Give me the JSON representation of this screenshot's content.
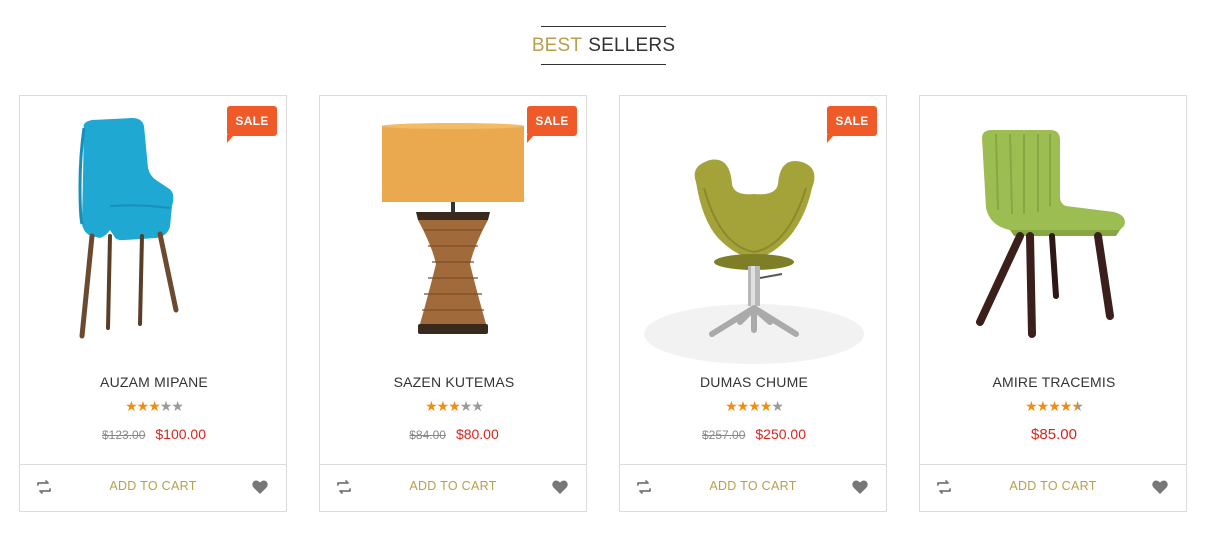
{
  "section": {
    "title_accent": "BEST",
    "title_rest": "SELLERS"
  },
  "colors": {
    "accent": "#b79f4c",
    "sale": "#f05a28",
    "price": "#d9251c",
    "star": "#f08c10"
  },
  "products": [
    {
      "name": "AUZAM MIPANE",
      "sale_label": "SALE",
      "rating": 3,
      "rating_max": 5,
      "old_price": "$123.00",
      "price": "$100.00",
      "cart_label": "ADD TO CART",
      "image": "blue-armchair"
    },
    {
      "name": "SAZEN KUTEMAS",
      "sale_label": "SALE",
      "rating": 3,
      "rating_max": 5,
      "old_price": "$84.00",
      "price": "$80.00",
      "cart_label": "ADD TO CART",
      "image": "table-lamp"
    },
    {
      "name": "DUMAS CHUME",
      "sale_label": "SALE",
      "rating": 4,
      "rating_max": 5,
      "old_price": "$257.00",
      "price": "$250.00",
      "cart_label": "ADD TO CART",
      "image": "green-swivel-chair"
    },
    {
      "name": "AMIRE TRACEMIS",
      "sale_label": "",
      "rating": 4.5,
      "rating_max": 5,
      "old_price": "",
      "price": "$85.00",
      "cart_label": "ADD TO CART",
      "image": "green-chair"
    }
  ],
  "icons": {
    "compare": "compare-icon",
    "wishlist": "heart-icon",
    "star": "star-icon"
  }
}
